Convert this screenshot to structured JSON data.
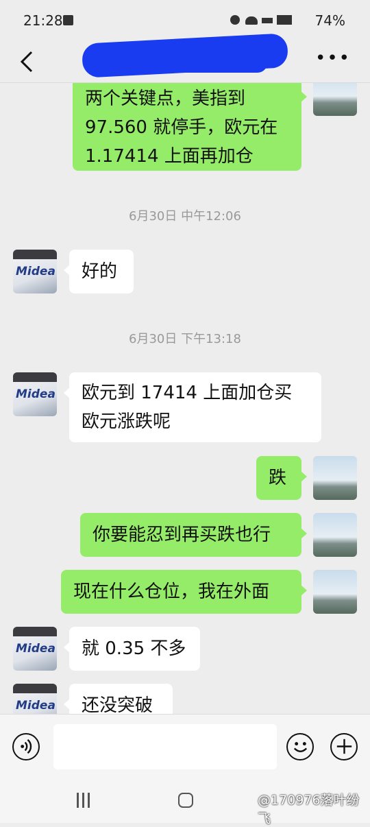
{
  "status": {
    "time": "21:28",
    "battery": "74%"
  },
  "header": {
    "more_icon": "ellipsis-icon",
    "back_icon": "chevron-left-icon"
  },
  "messages": [
    {
      "sender": "me",
      "lines": [
        "两个关键点，美指到",
        "97.560 就停手，欧元在",
        "1.17414 上面再加仓"
      ]
    },
    {
      "timestamp": "6月30日 中午12:06"
    },
    {
      "sender": "other",
      "lines": [
        "好的"
      ]
    },
    {
      "timestamp": "6月30日 下午13:18"
    },
    {
      "sender": "other",
      "lines": [
        "欧元到 17414 上面加仓买",
        "欧元涨跌呢"
      ]
    },
    {
      "sender": "me",
      "lines": [
        "跌"
      ]
    },
    {
      "sender": "me",
      "lines": [
        "你要能忍到再买跌也行"
      ]
    },
    {
      "sender": "me",
      "lines": [
        "现在什么仓位，我在外面"
      ]
    },
    {
      "sender": "other",
      "lines": [
        "就 0.35 不多"
      ]
    },
    {
      "sender": "other",
      "lines": [
        "还没突破"
      ]
    }
  ],
  "avatar_other_brand": "Midea",
  "input": {
    "voice_icon": "voice-icon",
    "emoji_icon": "emoji-icon",
    "plus_icon": "plus-icon"
  },
  "watermark": "@170976落叶纷飞"
}
